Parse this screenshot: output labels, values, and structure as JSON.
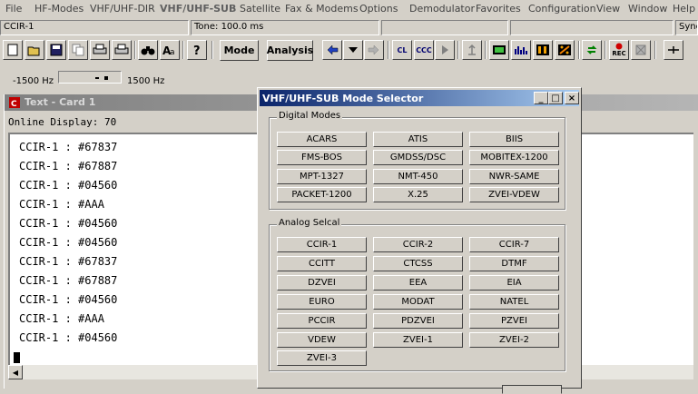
{
  "menu": [
    "File",
    "HF-Modes",
    "VHF/UHF-DIR",
    "VHF/UHF-SUB",
    "Satellite",
    "Fax & Modems",
    "Options",
    "Demodulator",
    "Favorites",
    "Configuration",
    "View",
    "Window",
    "Help"
  ],
  "status": {
    "mode": "CCIR-1",
    "tone": "Tone: 100.0 ms",
    "sync": "Sync"
  },
  "toolbar": {
    "mode_label": "Mode",
    "analysis_label": "Analysis",
    "cl_label": "CL",
    "ccc_label": "CCC",
    "rec_label": "REC"
  },
  "hz": {
    "left": "-1500 Hz",
    "right": "1500 Hz"
  },
  "card": {
    "title": "Text - Card 1",
    "online_display": "Online Display:  70"
  },
  "text_lines": [
    "CCIR-1 : #67837",
    "CCIR-1 : #67887",
    "CCIR-1 : #04560",
    "CCIR-1 : #AAA",
    "CCIR-1 : #04560",
    "CCIR-1 : #04560",
    "CCIR-1 : #67837",
    "CCIR-1 : #67887",
    "CCIR-1 : #04560",
    "CCIR-1 : #AAA",
    "CCIR-1 : #04560"
  ],
  "dialog": {
    "title": "VHF/UHF-SUB Mode Selector",
    "digital_label": "Digital Modes",
    "digital": [
      "ACARS",
      "ATIS",
      "BIIS",
      "FMS-BOS",
      "GMDSS/DSC",
      "MOBITEX-1200",
      "MPT-1327",
      "NMT-450",
      "NWR-SAME",
      "PACKET-1200",
      "X.25",
      "ZVEI-VDEW"
    ],
    "analog_label": "Analog Selcal",
    "analog": [
      "CCIR-1",
      "CCIR-2",
      "CCIR-7",
      "CCITT",
      "CTCSS",
      "DTMF",
      "DZVEI",
      "EEA",
      "EIA",
      "EURO",
      "MODAT",
      "NATEL",
      "PCCIR",
      "PDZVEI",
      "PZVEI",
      "VDEW",
      "ZVEI-1",
      "ZVEI-2",
      "ZVEI-3"
    ]
  }
}
